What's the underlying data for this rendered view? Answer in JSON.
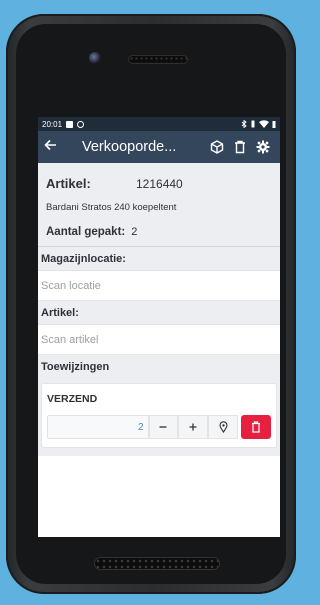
{
  "status_bar": {
    "time": "20:01"
  },
  "app_bar": {
    "title": "Verkooporde..."
  },
  "article": {
    "label": "Artikel:",
    "code": "1216440",
    "description": "Bardani Stratos 240 koepeltent",
    "picked_label": "Aantal gepakt:",
    "picked_value": "2"
  },
  "location": {
    "label": "Magazijnlocatie:",
    "placeholder": "Scan locatie"
  },
  "article_scan": {
    "label": "Artikel:",
    "placeholder": "Scan artikel"
  },
  "assignments": {
    "label": "Toewijzingen",
    "items": [
      {
        "name": "VERZEND",
        "quantity": "2"
      }
    ]
  },
  "colors": {
    "app_bar": "#33465c",
    "status_bar": "#1f2d3a",
    "delete_button": "#e8203f",
    "panel": "#eceef1",
    "quantity_text": "#5a7fb6"
  },
  "icons": [
    "back-arrow-icon",
    "package-icon",
    "trash-icon",
    "gear-icon",
    "minus-icon",
    "plus-icon",
    "location-pin-icon",
    "delete-icon"
  ]
}
